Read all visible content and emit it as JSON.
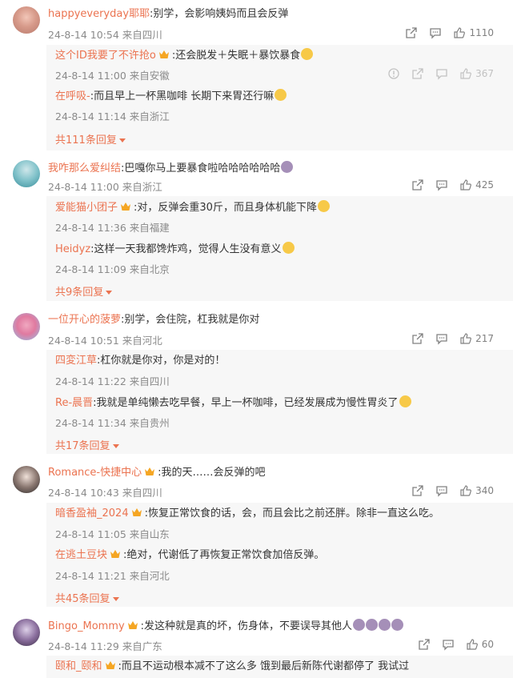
{
  "comments": [
    {
      "user": "happyeveryday耶耶",
      "text": ":别学，会影响姨妈而且会反弹",
      "meta": "24-8-14 10:54 来自四川",
      "likes": "1110",
      "replies": [
        {
          "user": "这个ID我要了不许抢o",
          "text": ":还会脱发＋失眠＋暴饮暴食",
          "meta": "24-8-14 11:00 来自安徽",
          "likes": "367"
        },
        {
          "user": "在呼吸-",
          "text": ":而且早上一杯黑咖啡 长期下来胃还行嘛",
          "meta": "24-8-14 11:14 来自浙江"
        }
      ],
      "more": "共111条回复"
    },
    {
      "user": "我咋那么爱纠结",
      "text": ":巴嘎你马上要暴食啦哈哈哈哈哈哈",
      "meta": "24-8-14 11:00 来自浙江",
      "likes": "425",
      "replies": [
        {
          "user": "爱能猫小团子",
          "text": ":对，反弹会重30斤，而且身体机能下降",
          "meta": "24-8-14 11:36 来自福建"
        },
        {
          "user": "Heidyz",
          "text": ":这样一天我都馋炸鸡，觉得人生没有意义",
          "meta": "24-8-14 11:09 来自北京"
        }
      ],
      "more": "共9条回复"
    },
    {
      "user": "一位开心的菠萝",
      "text": ":别学，会住院，杠我就是你对",
      "meta": "24-8-14 10:51 来自河北",
      "likes": "217",
      "replies": [
        {
          "user": "四変江草",
          "text": ":杠你就是你对，你是对的！",
          "meta": "24-8-14 11:22 来自四川"
        },
        {
          "user": "Re-晨晋",
          "text": ":我就是单纯懒去吃早餐，早上一杯咖啡，已经发展成为慢性胃炎了",
          "meta": "24-8-14 11:34 来自贵州"
        }
      ],
      "more": "共17条回复"
    },
    {
      "user": "Romance-快捷中心",
      "text": ":我的天……会反弹的吧",
      "meta": "24-8-14 10:43 来自四川",
      "likes": "340",
      "replies": [
        {
          "user": "暗香盈袖_2024",
          "text": ":恢复正常饮食的话，会，而且会比之前还胖。除非一直这么吃。",
          "meta": "24-8-14 11:05 来自山东"
        },
        {
          "user": "在逃土豆块",
          "text": ":绝对，代谢低了再恢复正常饮食加倍反弹。",
          "meta": "24-8-14 11:21 来自河北"
        }
      ],
      "more": "共45条回复"
    },
    {
      "user": "Bingo_Mommy",
      "text": ":发这种就是真的坏，伤身体，不要误导其他人",
      "meta": "24-8-14 11:29 来自广东",
      "likes": "60",
      "replies": [
        {
          "user": "颐和_颐和",
          "text": ":而且不运动根本减不了这么多 饿到最后新陈代谢都停了 我试过"
        }
      ]
    }
  ],
  "colors": {
    "username": "#eb7350",
    "meta": "#8a8a8a",
    "reply_bg": "#f7f7f7"
  }
}
